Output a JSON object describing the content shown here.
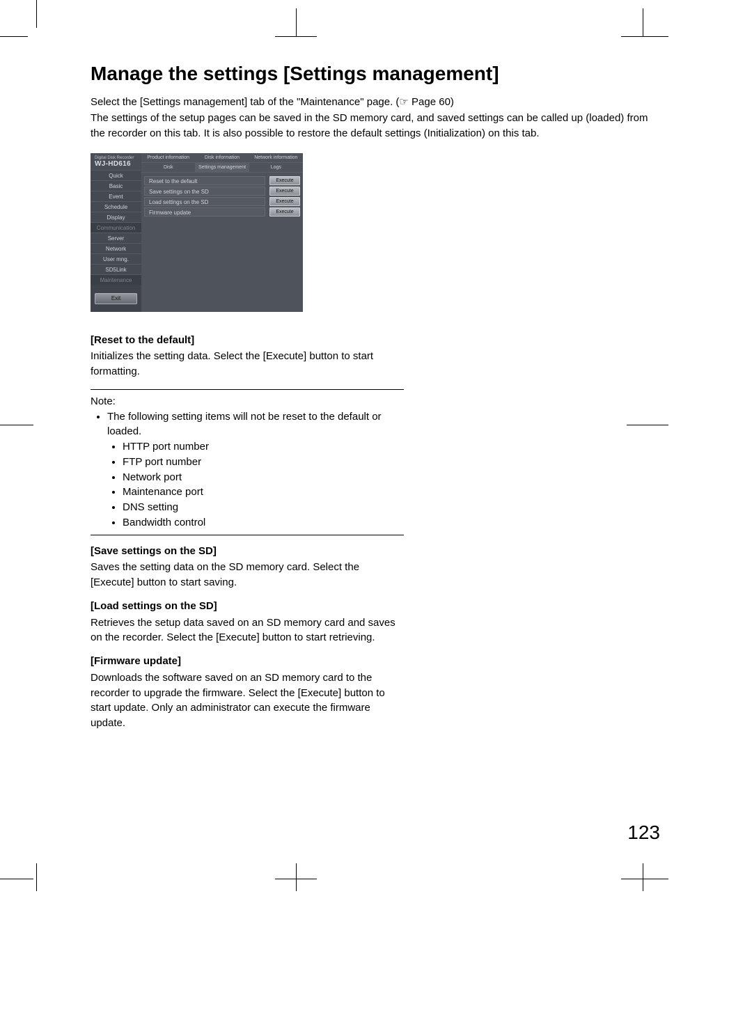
{
  "title": "Manage the settings [Settings management]",
  "intro_line1": "Select the [Settings management] tab of the \"Maintenance\" page. (☞ Page 60)",
  "intro_line2": "The settings of the setup pages can be saved in the SD memory card, and saved settings can be called up (loaded) from the recorder on this tab. It is also possible to restore the default settings (Initialization) on this tab.",
  "device": {
    "line1": "Digital Disk Recorder",
    "model": "WJ-HD616"
  },
  "sidebar": {
    "items": [
      "Quick",
      "Basic",
      "Event",
      "Schedule",
      "Display",
      "Communication",
      "Server",
      "Network",
      "User mng.",
      "SD5Link",
      "Maintenance"
    ],
    "exit": "Exit"
  },
  "tabs_row1": [
    "Product information",
    "Disk information",
    "Network information"
  ],
  "tabs_row2": [
    "Disk",
    "Settings management",
    "Logs"
  ],
  "rows": [
    {
      "label": "Reset to the default",
      "btn": "Execute"
    },
    {
      "label": "Save settings on the SD",
      "btn": "Execute"
    },
    {
      "label": "Load settings on the SD",
      "btn": "Execute"
    },
    {
      "label": "Firmware update",
      "btn": "Execute"
    }
  ],
  "sections": {
    "reset": {
      "h": "[Reset to the default]",
      "p": "Initializes the setting data. Select the [Execute] button to start formatting."
    },
    "note": {
      "title": "Note:",
      "lead": "The following setting items will not be reset to the default or loaded.",
      "items": [
        "HTTP port number",
        "FTP port number",
        "Network port",
        "Maintenance port",
        "DNS setting",
        "Bandwidth control"
      ]
    },
    "save": {
      "h": "[Save settings on the SD]",
      "p": "Saves the setting data on the SD memory card. Select the [Execute] button to start saving."
    },
    "load": {
      "h": "[Load settings on the SD]",
      "p": "Retrieves the setup data saved on an SD memory card and saves on the recorder. Select the [Execute] button to start retrieving."
    },
    "fw": {
      "h": "[Firmware update]",
      "p": "Downloads the software saved on an SD memory card to the recorder to upgrade the firmware. Select the [Execute] button to start update. Only an administrator can execute the firmware update."
    }
  },
  "page_number": "123"
}
